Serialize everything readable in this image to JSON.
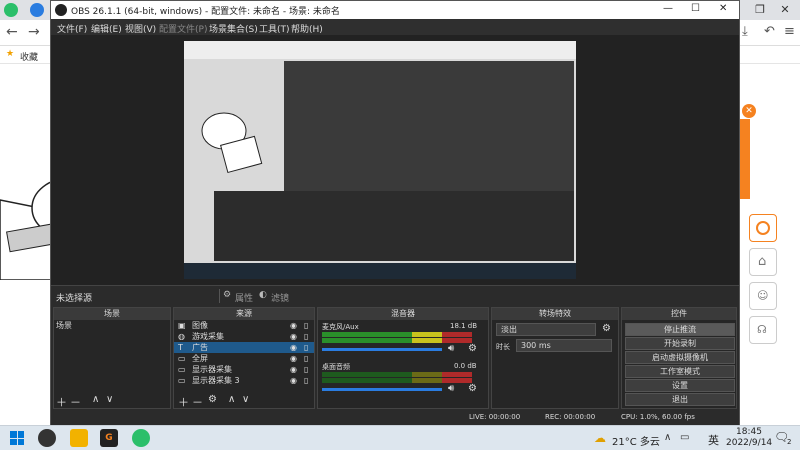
{
  "obs": {
    "title": "OBS 26.1.1 (64-bit, windows) - 配置文件: 未命名 - 场景: 未命名",
    "menu": [
      "文件(F)",
      "编辑(E)",
      "视图(V)",
      "配置文件(P)",
      "场景集合(S)",
      "工具(T)",
      "帮助(H)"
    ],
    "toolbar": {
      "no_source": "未选择源",
      "properties": "属性",
      "filters": "滤镜"
    },
    "docks": {
      "scenes": {
        "title": "场景",
        "items": [
          "场景"
        ]
      },
      "sources": {
        "title": "来源",
        "items": [
          {
            "label": "图像",
            "icon": "image-icon"
          },
          {
            "label": "游戏采集",
            "icon": "gamepad-icon"
          },
          {
            "label": "广告",
            "icon": "text-icon",
            "selected": true
          },
          {
            "label": "全屏",
            "icon": "monitor-icon"
          },
          {
            "label": "显示器采集",
            "icon": "monitor-icon"
          },
          {
            "label": "显示器采集 3",
            "icon": "monitor-icon"
          }
        ]
      },
      "mixer": {
        "title": "混音器",
        "channels": [
          {
            "name": "麦克风/Aux",
            "db": "18.1 dB"
          },
          {
            "name": "桌面音频",
            "db": "0.0 dB"
          }
        ]
      },
      "transitions": {
        "title": "转场特效",
        "type": "淡出",
        "duration_label": "时长",
        "duration_value": "300 ms"
      },
      "controls": {
        "title": "控件",
        "buttons": [
          "停止推流",
          "开始录制",
          "启动虚拟摄像机",
          "工作室模式",
          "设置",
          "退出"
        ]
      }
    },
    "status": {
      "live": "LIVE: 00:00:00",
      "rec": "REC: 00:00:00",
      "cpu": "CPU: 1.0%, 60.00 fps"
    }
  },
  "browser": {
    "bookmark": "收藏"
  },
  "taskbar": {
    "weather": "21°C 多云",
    "ime": "英",
    "time": "18:45",
    "date": "2022/9/14",
    "notif": "2"
  },
  "colors": {
    "accent": "#f58220",
    "selected": "#1f5a8c"
  }
}
